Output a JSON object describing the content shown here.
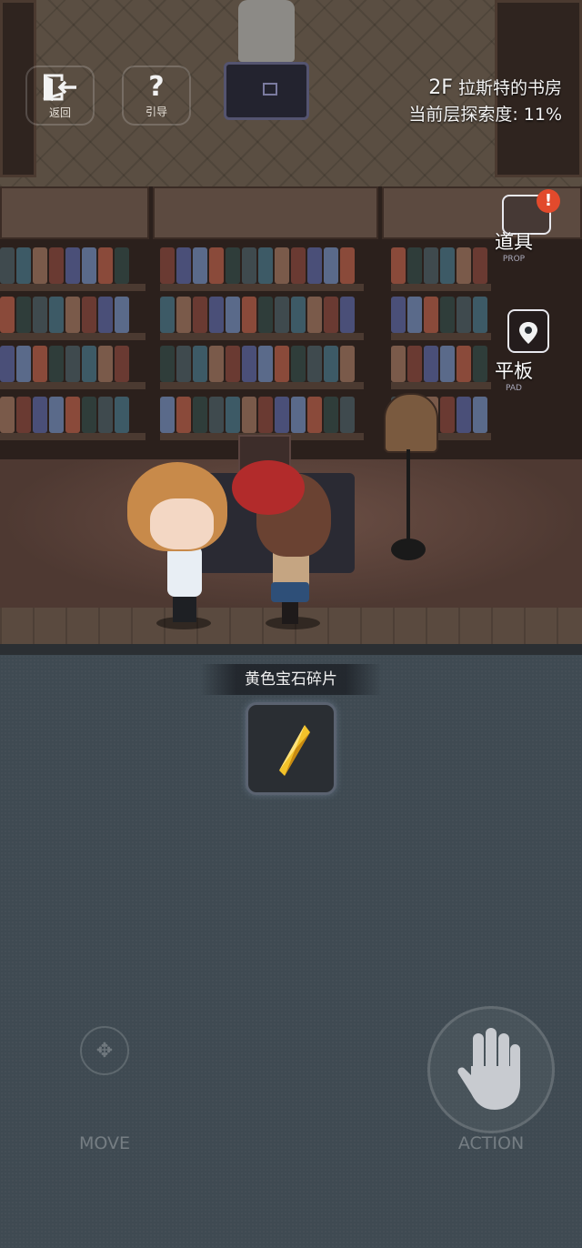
{
  "hud": {
    "back_label": "返回",
    "guide_label": "引导",
    "back_icon": "exit-door-icon",
    "guide_icon": "question-mark-icon"
  },
  "floor_info": {
    "floor": "2F",
    "location": "拉斯特的书房",
    "exploration_label": "当前层探索度:",
    "exploration_value": "11%"
  },
  "side_menu": {
    "prop": {
      "label_zh": "道具",
      "label_en": "PROP",
      "icon": "treasure-chest-icon",
      "alert": "!"
    },
    "pad": {
      "label_zh": "平板",
      "label_en": "PAD",
      "icon": "map-pin-icon"
    }
  },
  "inventory": {
    "item_name": "黄色宝石碎片",
    "item_icon": "yellow-gem-shard-icon",
    "item_color": "#e8b820"
  },
  "controls": {
    "move_label": "MOVE",
    "action_label": "ACTION",
    "move_icon": "dpad-icon",
    "action_icon": "hand-icon"
  },
  "colors": {
    "panel_bg": "#3f4a52",
    "alert": "#e24a2c"
  }
}
